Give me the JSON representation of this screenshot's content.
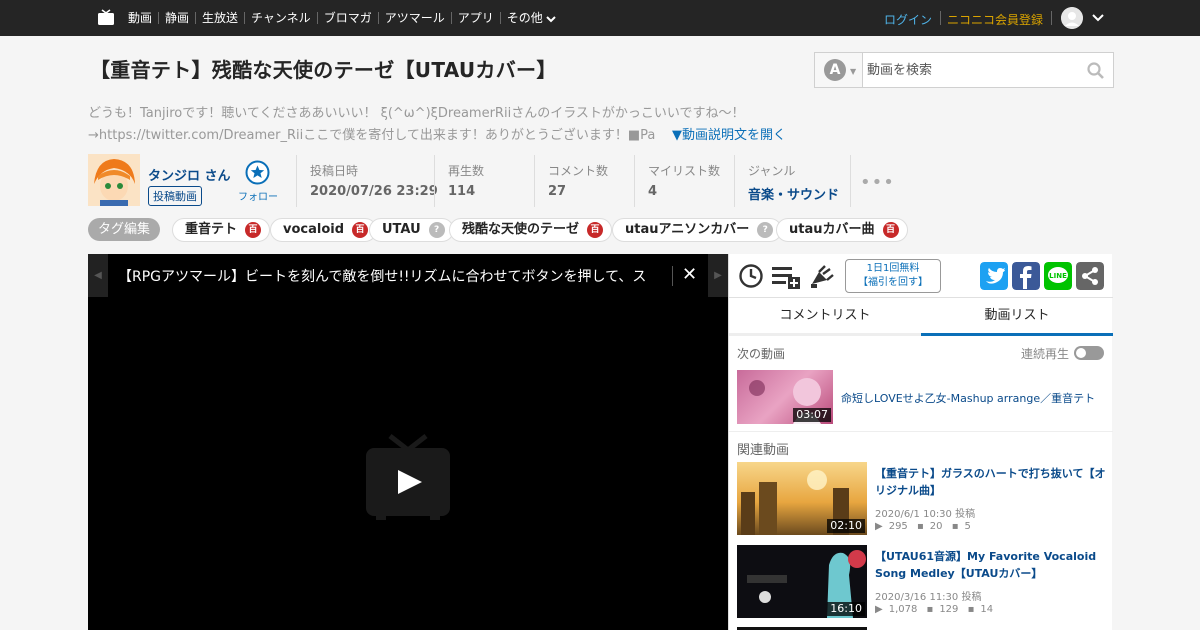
{
  "topbar": {
    "nav": [
      "動画",
      "静画",
      "生放送",
      "チャンネル",
      "ブロマガ",
      "アツマール",
      "アプリ",
      "その他"
    ],
    "login": "ログイン",
    "register": "ニコニコ会員登録"
  },
  "video": {
    "title": "【重音テト】残酷な天使のテーゼ【UTAUカバー】",
    "description_line1": "どうも！Tanjiroです！聴いてくださああいいい！ ξ(^ω^)ξDreamerRiiさんのイラストがかっこいいですね～！",
    "description_line2": "→https://twitter.com/Dreamer_Riiここで僕を寄付して出来ます！ありがとうございます！■Pa",
    "description_more": "▼動画説明文を開く"
  },
  "search": {
    "placeholder": "動画を検索",
    "mode_glyph": "A"
  },
  "owner": {
    "name": "タンジロ さん",
    "videos_label": "投稿動画",
    "follow_label": "フォロー"
  },
  "stats": {
    "posted_label": "投稿日時",
    "posted_value": "2020/07/26 23:29",
    "views_label": "再生数",
    "views_value": "114",
    "comments_label": "コメント数",
    "comments_value": "27",
    "mylist_label": "マイリスト数",
    "mylist_value": "4",
    "genre_label": "ジャンル",
    "genre_value": "音楽・サウンド",
    "more": "•••"
  },
  "tags": {
    "edit_label": "タグ編集",
    "items": [
      {
        "label": "重音テト",
        "badge": "百",
        "color": "#c72929"
      },
      {
        "label": "vocaloid",
        "badge": "百",
        "color": "#c72929"
      },
      {
        "label": "UTAU",
        "badge": "?",
        "color": "#bbbbbb"
      },
      {
        "label": "残酷な天使のテーゼ",
        "badge": "百",
        "color": "#c72929"
      },
      {
        "label": "utauアニソンカバー",
        "badge": "?",
        "color": "#bbbbbb"
      },
      {
        "label": "utauカバー曲",
        "badge": "百",
        "color": "#c72929"
      }
    ]
  },
  "player": {
    "notice": "【RPGアツマール】ビートを刻んで敵を倒せ!!リズムに合わせてボタンを押して、ス",
    "close": "✕"
  },
  "sidebar": {
    "free_line1": "1日1回無料",
    "free_line2": "【福引を回す】",
    "tab_comments": "コメントリスト",
    "tab_videos": "動画リスト",
    "next_label": "次の動画",
    "autoplay_label": "連続再生",
    "next_video": {
      "title": "命短しLOVEせよ乙女-Mashup arrange／重音テト",
      "duration": "03:07"
    },
    "related_label": "関連動画",
    "related": [
      {
        "title": "【重音テト】ガラスのハートで打ち抜いて【オリジナル曲】",
        "duration": "02:10",
        "date": "2020/6/1 10:30 投稿",
        "views": "295",
        "comments": "20",
        "mylists": "5"
      },
      {
        "title": "【UTAU61音源】My Favorite Vocaloid Song Medley【UTAUカバー】",
        "duration": "16:10",
        "date": "2020/3/16 11:30 投稿",
        "views": "1,078",
        "comments": "129",
        "mylists": "14"
      }
    ]
  },
  "colors": {
    "accent": "#0a6fb8",
    "topbar": "#252525",
    "tag_red": "#c72929",
    "twitter": "#1da1f2",
    "facebook": "#3b5998",
    "line": "#00c300"
  }
}
